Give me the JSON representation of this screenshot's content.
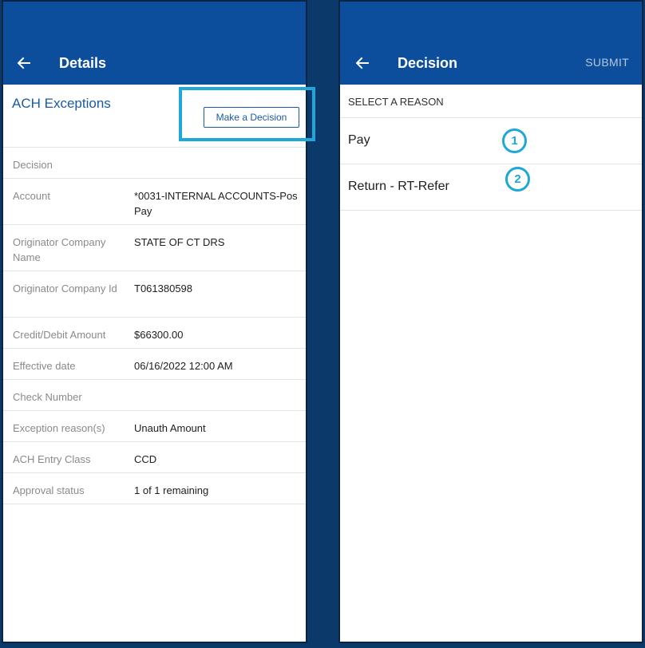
{
  "left_screen": {
    "title": "Details",
    "section_title": "ACH Exceptions",
    "decision_button": "Make a Decision",
    "fields": [
      {
        "label": "Decision",
        "value": ""
      },
      {
        "label": "Account",
        "value": "*0031-INTERNAL ACCOUNTS-Pos Pay"
      },
      {
        "label": "Originator Company Name",
        "value": "STATE OF CT DRS"
      },
      {
        "label": "Originator Company Id",
        "value": "T061380598"
      },
      {
        "label": "Credit/Debit Amount",
        "value": "$66300.00"
      },
      {
        "label": "Effective date",
        "value": "06/16/2022 12:00 AM"
      },
      {
        "label": "Check Number",
        "value": ""
      },
      {
        "label": "Exception reason(s)",
        "value": "Unauth Amount"
      },
      {
        "label": "ACH Entry Class",
        "value": "CCD"
      },
      {
        "label": "Approval status",
        "value": "1 of 1 remaining"
      }
    ]
  },
  "right_screen": {
    "title": "Decision",
    "submit_label": "SUBMIT",
    "reason_header": "SELECT A REASON",
    "options": [
      {
        "label": "Pay",
        "badge": "1"
      },
      {
        "label": "Return - RT-Refer",
        "badge": "2"
      }
    ]
  },
  "colors": {
    "background": "#0b3a6a",
    "app_bar": "#0d4e9c",
    "accent_link": "#1b5aa3",
    "callout": "#1ea7d8"
  },
  "icons": {
    "back": "arrow-left-icon"
  }
}
